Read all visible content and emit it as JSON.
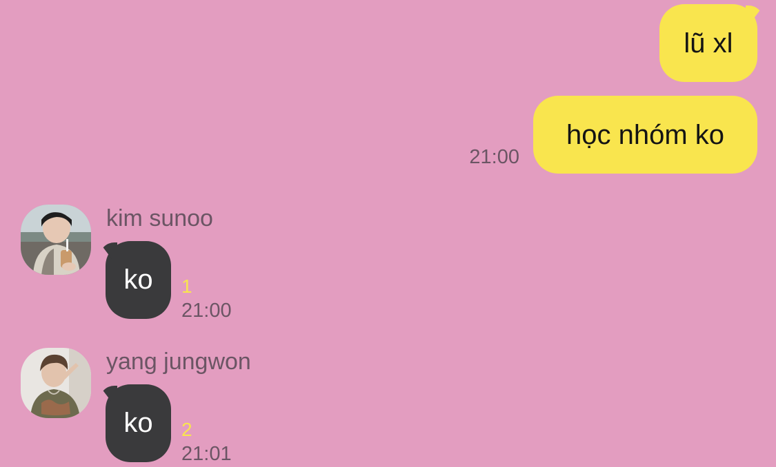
{
  "outgoing": [
    {
      "text": "lũ xl"
    },
    {
      "text": "học nhóm ko",
      "time": "21:00"
    }
  ],
  "incoming": [
    {
      "sender": "kim sunoo",
      "avatar_icon": "profile-photo",
      "text": "ko",
      "unread": "1",
      "time": "21:00"
    },
    {
      "sender": "yang jungwon",
      "avatar_icon": "profile-photo",
      "text": "ko",
      "unread": "2",
      "time": "21:01"
    }
  ],
  "colors": {
    "background": "#e39dc0",
    "outgoing_bubble": "#f9e54e",
    "incoming_bubble": "#3a3a3c",
    "unread_count": "#f9e54e",
    "meta_text": "#6b5564"
  }
}
